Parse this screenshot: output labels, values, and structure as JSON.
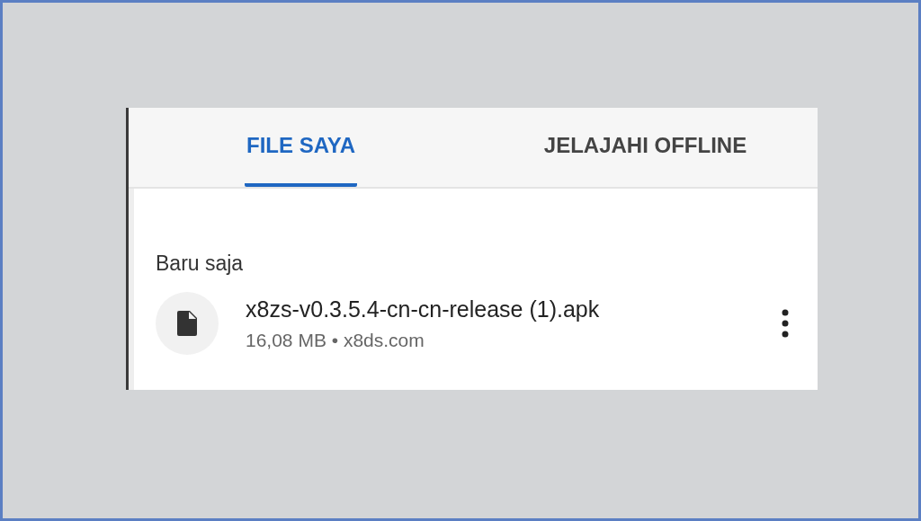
{
  "tabs": [
    {
      "label": "FILE SAYA",
      "selected": true
    },
    {
      "label": "JELAJAHI OFFLINE",
      "selected": false
    }
  ],
  "section": {
    "title": "Baru saja"
  },
  "files": [
    {
      "name": "x8zs-v0.3.5.4-cn-cn-release (1).apk",
      "meta": "16,08 MB • x8ds.com"
    }
  ]
}
